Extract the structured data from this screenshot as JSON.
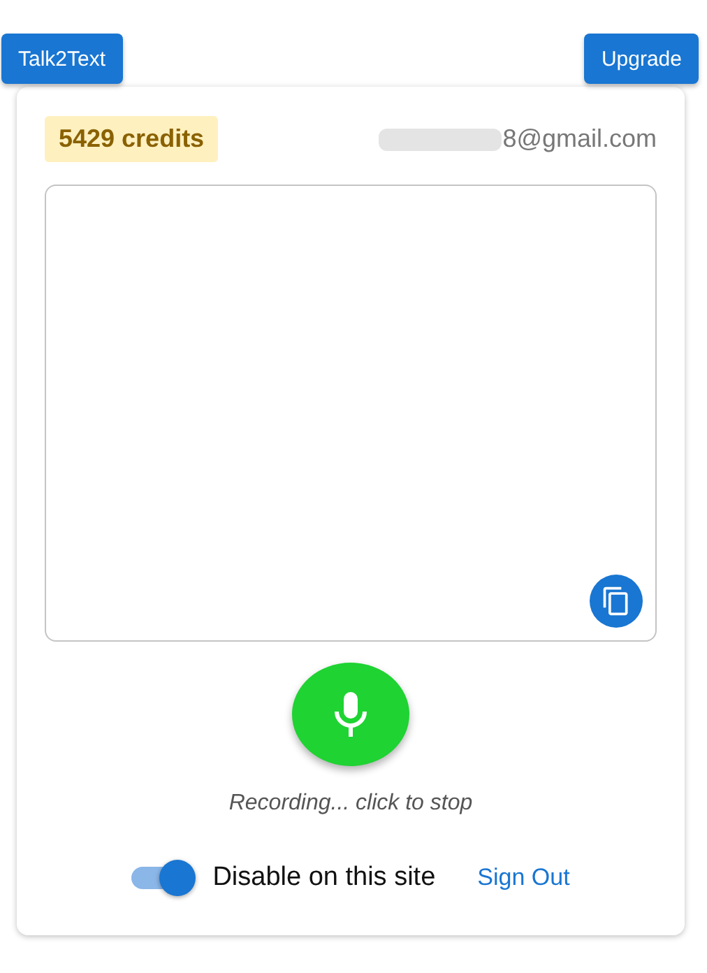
{
  "header_buttons": [
    {
      "label": "Talk2Text"
    },
    {
      "label": "Upgrade"
    }
  ],
  "credits": "5429 credits",
  "email": "8@gmail.com",
  "mic": {
    "recording": true
  },
  "status": "Recording... click to stop",
  "site_toggle": {
    "label": "Disable on this site",
    "on": true
  },
  "sign_out": "Sign Out"
}
